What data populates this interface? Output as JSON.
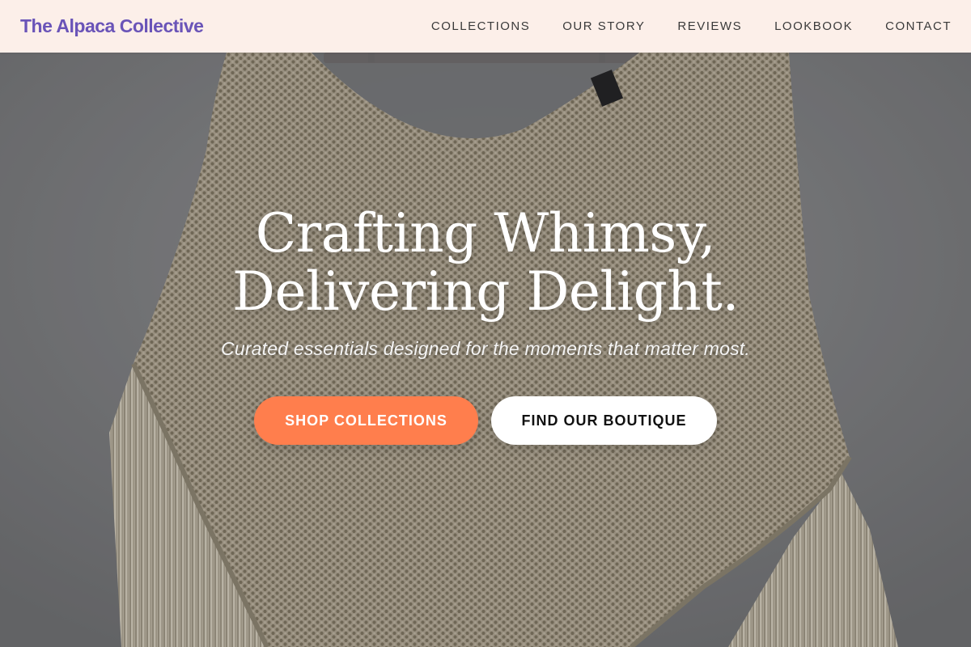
{
  "header": {
    "brand": "The Alpaca Collective",
    "nav": [
      {
        "label": "COLLECTIONS"
      },
      {
        "label": "OUR STORY"
      },
      {
        "label": "REVIEWS"
      },
      {
        "label": "LOOKBOOK"
      },
      {
        "label": "CONTACT"
      }
    ]
  },
  "hero": {
    "title_line1": "Crafting Whimsy,",
    "title_line2": "Delivering Delight.",
    "subtitle": "Curated essentials designed for the moments that matter most.",
    "primary_cta": "SHOP COLLECTIONS",
    "secondary_cta": "FIND OUR BOUTIQUE",
    "image_subject": "cream knit fringed poncho on wooden hanger"
  },
  "colors": {
    "brand": "#6a54b8",
    "header_bg": "#fcefe9",
    "primary_button": "#ff7e4d",
    "secondary_button": "#ffffff",
    "hero_text": "#ffffff"
  }
}
